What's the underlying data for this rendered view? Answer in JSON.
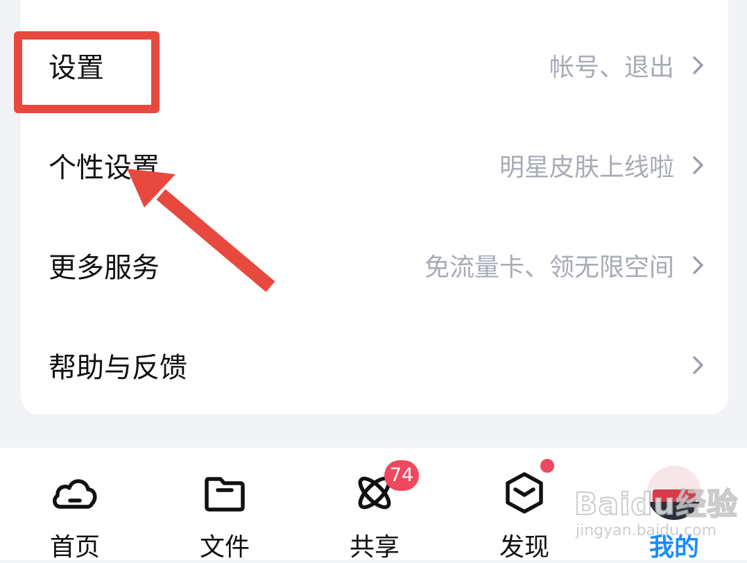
{
  "menu": {
    "items": [
      {
        "label": "设置",
        "hint": "帐号、退出"
      },
      {
        "label": "个性设置",
        "hint": "明星皮肤上线啦"
      },
      {
        "label": "更多服务",
        "hint": "免流量卡、领无限空间"
      },
      {
        "label": "帮助与反馈",
        "hint": ""
      }
    ]
  },
  "tabs": [
    {
      "label": "首页",
      "icon": "cloud-icon",
      "active": false
    },
    {
      "label": "文件",
      "icon": "folder-icon",
      "active": false
    },
    {
      "label": "共享",
      "icon": "orbit-icon",
      "active": false,
      "badge": "74"
    },
    {
      "label": "发现",
      "icon": "cube-icon",
      "active": false,
      "dot": true
    },
    {
      "label": "我的",
      "icon": "avatar",
      "active": true
    }
  ],
  "watermark": {
    "main": "Baidu经验",
    "sub": "jingyan.baidu.com"
  },
  "colors": {
    "accent": "#1a8cff",
    "annotation": "#e8493e",
    "badge": "#f0485e",
    "hint_text": "#a7abb5",
    "background": "#f2f3f7"
  }
}
